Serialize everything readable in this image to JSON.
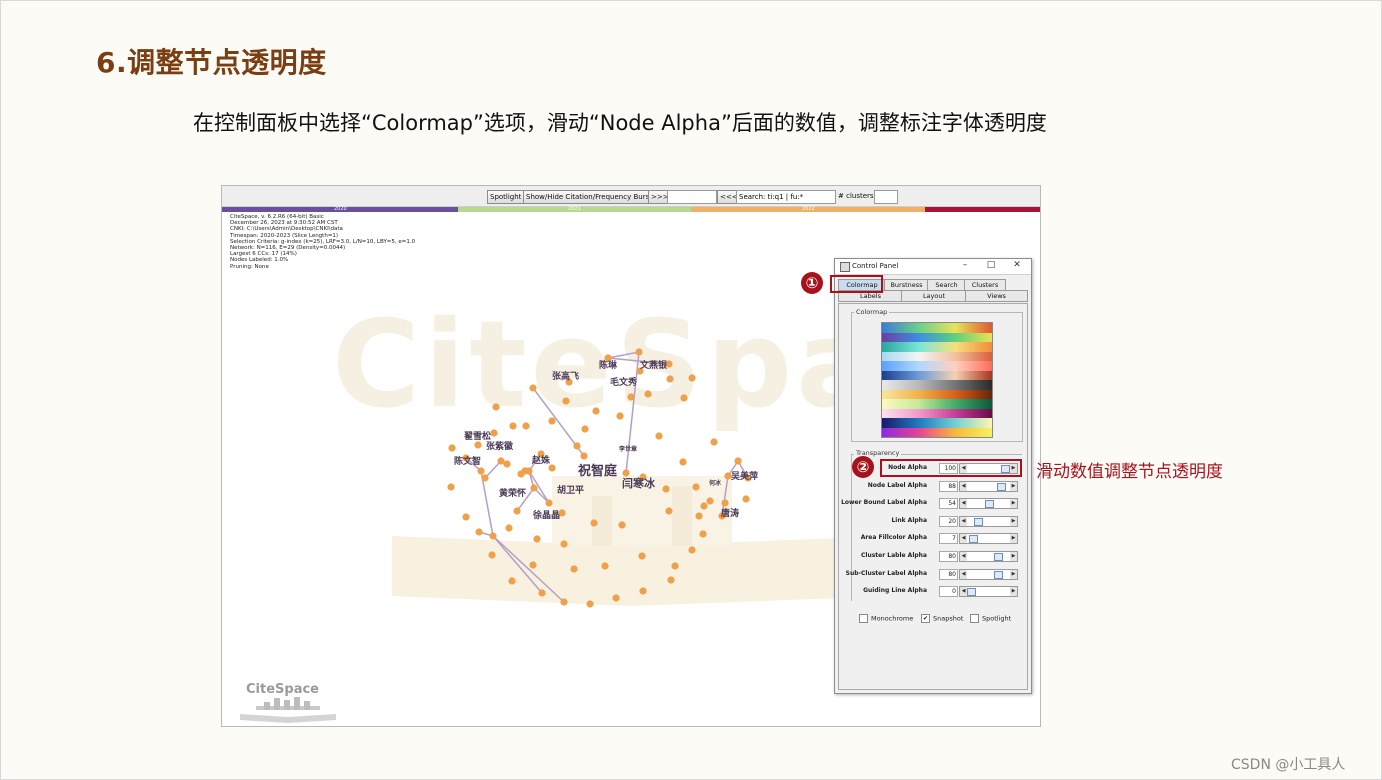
{
  "slide": {
    "title": "6.调整节点透明度",
    "subtitle": "在控制面板中选择“Colormap”选项，滑动“Node Alpha”后面的数值，调整标注字体透明度",
    "annotation": "滑动数值调整节点透明度",
    "footer": "CSDN @小工具人",
    "markers": [
      "①",
      "②"
    ]
  },
  "toolbar": {
    "spotlight": "Spotlight",
    "show_hide": "Show/Hide Citation/Frequency Burst",
    "next": ">>>",
    "prev": "<<<",
    "search_value": "Search: ti:q1 | fu:*",
    "clusters_label": "# clusters"
  },
  "timeline": {
    "colors": [
      "#6a4fa0",
      "#b6d98f",
      "#f2b064",
      "#a8133c"
    ],
    "labels": [
      "2020",
      "2021",
      "2022"
    ]
  },
  "info_lines": [
    "CiteSpace, v. 6.2.R6 (64-bit) Basic",
    "December 26, 2023 at 9:30:52 AM CST",
    "CNKI: C:\\Users\\Admin\\Desktop\\CNKI\\data",
    "Timespan: 2020-2023 (Slice Length=1)",
    "Selection Criteria: g-index (k=25), LRF=3.0, L/N=10, LBY=5, e=1.0",
    "Network: N=116, E=29 (Density=0.0044)",
    "Largest 6 CCs: 17 (14%)",
    "Nodes Labeled: 1.0%",
    "Pruning: None"
  ],
  "watermark": "CiteSpace",
  "logo": "CiteSpace",
  "network": {
    "node_color": "#f0a048",
    "labels": [
      "陈琳",
      "文燕银",
      "张高飞",
      "毛文秀",
      "翟雪松",
      "张紫徽",
      "陈文智",
      "赵姝",
      "祝智庭",
      "闫寒冰",
      "胡卫平",
      "黄荣怀",
      "徐晶晶",
      "吴美萍",
      "唐涛",
      "何冰",
      "李世章"
    ]
  },
  "control_panel": {
    "title": "Control Panel",
    "tabs_row1": [
      "Colormap",
      "Burstness",
      "Search",
      "Clusters"
    ],
    "tabs_row2": [
      "Labels",
      "Layout",
      "Views"
    ],
    "colormap_label": "Colormap",
    "transparency_label": "Transparency",
    "rows": [
      {
        "name": "Node Alpha",
        "value": "100",
        "level": 100
      },
      {
        "name": "Node Label Alpha",
        "value": "88",
        "level": 88
      },
      {
        "name": "Lower Bound Label Alpha",
        "value": "54",
        "level": 54
      },
      {
        "name": "Link Alpha",
        "value": "20",
        "level": 20
      },
      {
        "name": "Area Fillcolor Alpha",
        "value": "7",
        "level": 7
      },
      {
        "name": "Cluster Lable Alpha",
        "value": "80",
        "level": 80
      },
      {
        "name": "Sub-Cluster Label Alpha",
        "value": "80",
        "level": 80
      },
      {
        "name": "Guiding Line Alpha",
        "value": "0",
        "level": 0
      }
    ],
    "checkboxes": [
      {
        "label": "Monochrome",
        "checked": false
      },
      {
        "label": "Snapshot",
        "checked": true
      },
      {
        "label": "Spotlight",
        "checked": false
      }
    ],
    "colormap_gradients": [
      [
        "#3a7bd5",
        "#6ad08a",
        "#e8e35a",
        "#e4572e"
      ],
      [
        "#6b3fa0",
        "#3e8ee0",
        "#5fd07c",
        "#ece14d"
      ],
      [
        "#2aa5a0",
        "#79e6d6",
        "#f5e07d",
        "#f38b3a"
      ],
      [
        "#a8d8f0",
        "#f4f4f4",
        "#f2c0a0",
        "#d9603a"
      ],
      [
        "#5aa0ff",
        "#b0d8ff",
        "#ffd0c0",
        "#ff6a5a"
      ],
      [
        "#1e3c8c",
        "#6c9cd8",
        "#f2d2b0",
        "#a8341e"
      ],
      [
        "#e9e9e9",
        "#b9b9b9",
        "#747474",
        "#2a2a2a"
      ],
      [
        "#f7e6a0",
        "#f2b34a",
        "#d7601d",
        "#6a2406"
      ],
      [
        "#fff9c0",
        "#c3ea9a",
        "#3fae6a",
        "#0b5a3a"
      ],
      [
        "#fbe2f0",
        "#f29bc9",
        "#c63e97",
        "#6a0a4a"
      ],
      [
        "#1a1a6a",
        "#1f7ac0",
        "#74d0d0",
        "#fff6b0"
      ],
      [
        "#8a2be2",
        "#e84393",
        "#f6b93b",
        "#f8f35e"
      ]
    ]
  }
}
